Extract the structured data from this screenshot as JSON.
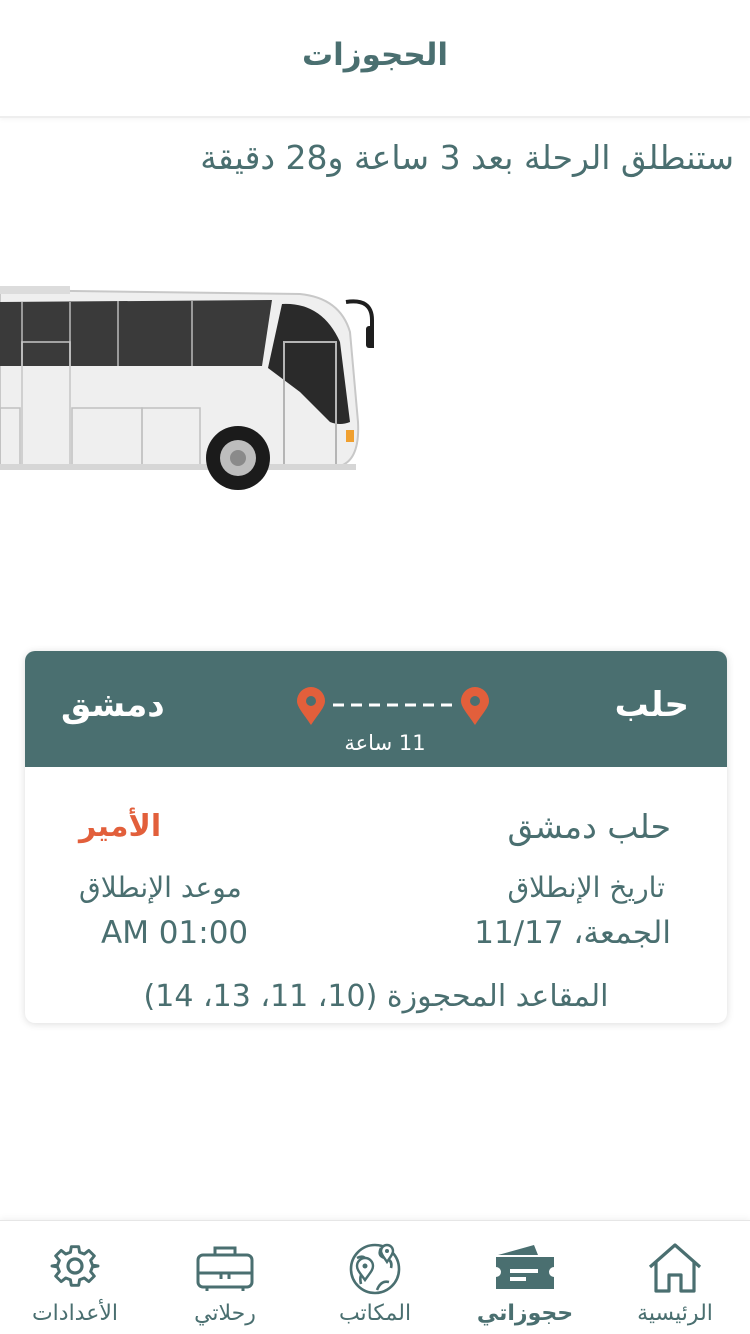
{
  "header": {
    "title": "الحجوزات"
  },
  "countdown_text": "ستنطلق الرحلة بعد  3 ساعة و28 دقيقة",
  "booking": {
    "from_city": "حلب",
    "to_city": "دمشق",
    "duration": "11 ساعة",
    "route": "حلب دمشق",
    "operator": "الأمير",
    "departure_date_label": "تاريخ الإنطلاق",
    "departure_date": "الجمعة، 11/17",
    "departure_time_label": "موعد الإنطلاق",
    "departure_time": "AM 01:00",
    "seats": "المقاعد المحجوزة (10، 11، 13، 14)"
  },
  "tabbar": {
    "items": [
      {
        "label": "الرئيسية",
        "icon": "home-icon"
      },
      {
        "label": "حجوزاتي",
        "icon": "ticket-icon",
        "active": true
      },
      {
        "label": "المكاتب",
        "icon": "globe-location-icon"
      },
      {
        "label": "رحلاتي",
        "icon": "suitcase-icon"
      },
      {
        "label": "الأعدادات",
        "icon": "gear-icon"
      }
    ]
  },
  "colors": {
    "primary": "#4a6f70",
    "accent": "#e25f3b",
    "background": "#ffffff"
  }
}
